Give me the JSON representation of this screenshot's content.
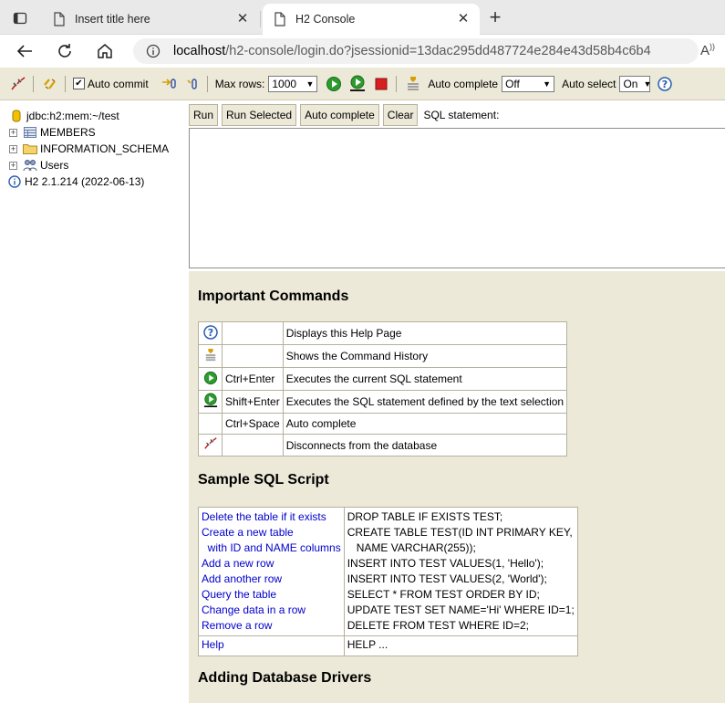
{
  "browser": {
    "tabs": [
      {
        "title": "Insert title here",
        "active": false
      },
      {
        "title": "H2 Console",
        "active": true
      }
    ],
    "url_host": "localhost",
    "url_rest": "/h2-console/login.do?jsessionid=13dac295dd487724e284e43d58b4c6b4"
  },
  "toolbar": {
    "auto_commit_label": "Auto commit",
    "auto_commit_checked": true,
    "max_rows_label": "Max rows:",
    "max_rows_value": "1000",
    "auto_complete_label": "Auto complete",
    "auto_complete_value": "Off",
    "auto_select_label": "Auto select",
    "auto_select_value": "On",
    "help_glyph": "?"
  },
  "tree": {
    "connection": "jdbc:h2:mem:~/test",
    "items": [
      {
        "label": "MEMBERS",
        "icon": "table-icon"
      },
      {
        "label": "INFORMATION_SCHEMA",
        "icon": "folder-icon"
      },
      {
        "label": "Users",
        "icon": "users-icon"
      }
    ],
    "version": "H2 2.1.214 (2022-06-13)"
  },
  "sql": {
    "run": "Run",
    "run_selected": "Run Selected",
    "auto_complete": "Auto complete",
    "clear": "Clear",
    "statement_label": "SQL statement:"
  },
  "help": {
    "important_title": "Important Commands",
    "commands": [
      {
        "icon": "help-icon",
        "key": "",
        "desc": "Displays this Help Page"
      },
      {
        "icon": "history-icon",
        "key": "",
        "desc": "Shows the Command History"
      },
      {
        "icon": "run-icon",
        "key": "Ctrl+Enter",
        "desc": "Executes the current SQL statement"
      },
      {
        "icon": "run-selected-icon",
        "key": "Shift+Enter",
        "desc": "Executes the SQL statement defined by the text selection"
      },
      {
        "icon": "",
        "key": "Ctrl+Space",
        "desc": "Auto complete"
      },
      {
        "icon": "disconnect-icon",
        "key": "",
        "desc": "Disconnects from the database"
      }
    ],
    "sample_title": "Sample SQL Script",
    "script_labels": [
      "Delete the table if it exists",
      "Create a new table",
      "  with ID and NAME columns",
      "Add a new row",
      "Add another row",
      "Query the table",
      "Change data in a row",
      "Remove a row"
    ],
    "script_sql": [
      "DROP TABLE IF EXISTS TEST;",
      "CREATE TABLE TEST(ID INT PRIMARY KEY,",
      "   NAME VARCHAR(255));",
      "INSERT INTO TEST VALUES(1, 'Hello');",
      "INSERT INTO TEST VALUES(2, 'World');",
      "SELECT * FROM TEST ORDER BY ID;",
      "UPDATE TEST SET NAME='Hi' WHERE ID=1;",
      "DELETE FROM TEST WHERE ID=2;"
    ],
    "help_link": "Help",
    "help_sql": "HELP ...",
    "drivers_title": "Adding Database Drivers"
  },
  "colors": {
    "panel": "#ece9d8",
    "link": "#0000cc",
    "run_green": "#2e9b2e",
    "stop_red": "#d62020"
  }
}
